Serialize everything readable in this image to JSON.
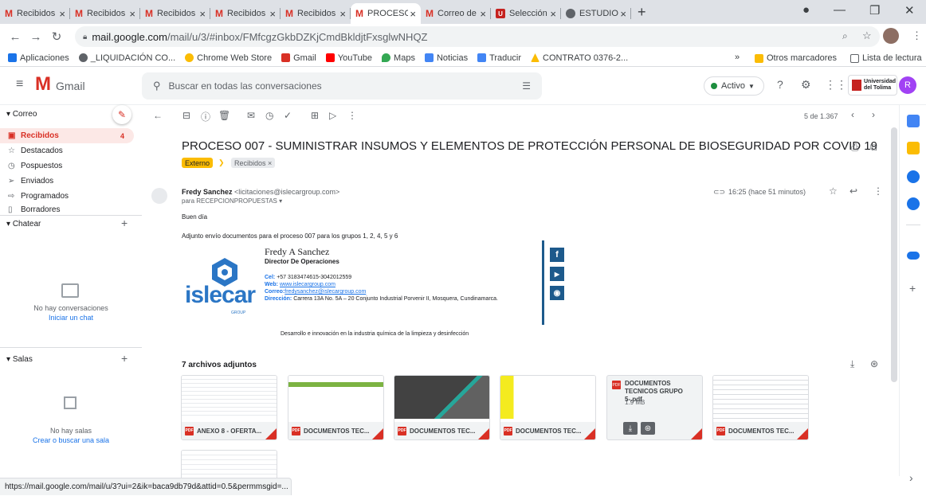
{
  "tabs": [
    {
      "label": "Recibidos (",
      "favicon": "gmail-icon",
      "active": false
    },
    {
      "label": "Recibidos (",
      "favicon": "gmail-icon",
      "active": false
    },
    {
      "label": "Recibidos (",
      "favicon": "gmail-icon",
      "active": false
    },
    {
      "label": "Recibidos (",
      "favicon": "gmail-icon",
      "active": false
    },
    {
      "label": "Recibidos (",
      "favicon": "gmail-icon",
      "active": false
    },
    {
      "label": "PROCESO (",
      "favicon": "gmail-icon",
      "active": true
    },
    {
      "label": "Correo de",
      "favicon": "gmail-icon",
      "active": false
    },
    {
      "label": "Selección",
      "favicon": "university-icon",
      "active": false
    },
    {
      "label": "ESTUDIOS",
      "favicon": "globe-icon",
      "active": false
    }
  ],
  "address": {
    "host": "mail.google.com",
    "path": "/mail/u/3/#inbox/FMfcgzGkbDZKjCmdBkldjtFxsglwNHQZ"
  },
  "bookmarks": {
    "items": [
      {
        "label": "Aplicaciones",
        "color": "#1a73e8"
      },
      {
        "label": "_LIQUIDACIÓN CO...",
        "color": "#5f6368"
      },
      {
        "label": "Chrome Web Store",
        "color": "#fbbc04"
      },
      {
        "label": "Gmail",
        "color": "#d93025"
      },
      {
        "label": "YouTube",
        "color": "#ff0000"
      },
      {
        "label": "Maps",
        "color": "#34a853"
      },
      {
        "label": "Noticias",
        "color": "#4285f4"
      },
      {
        "label": "Traducir",
        "color": "#4285f4"
      },
      {
        "label": "CONTRATO 0376-2...",
        "color": "#fbbc04"
      }
    ],
    "more": "»",
    "otros": "Otros marcadores",
    "lista": "Lista de lectura"
  },
  "gmail": {
    "logo": "Gmail",
    "search_placeholder": "Buscar en todas las conversaciones",
    "status": "Activo",
    "university_logo_line1": "Universidad",
    "university_logo_line2": "del Tolima",
    "avatar_letter": "R"
  },
  "sidebar": {
    "correo_header": "Correo",
    "items": [
      {
        "label": "Recibidos",
        "count": "4",
        "icon": "inbox-icon",
        "selected": true
      },
      {
        "label": "Destacados",
        "count": "",
        "icon": "star-icon",
        "selected": false
      },
      {
        "label": "Pospuestos",
        "count": "",
        "icon": "clock-icon",
        "selected": false
      },
      {
        "label": "Enviados",
        "count": "",
        "icon": "send-icon",
        "selected": false
      },
      {
        "label": "Programados",
        "count": "",
        "icon": "scheduled-icon",
        "selected": false
      },
      {
        "label": "Borradores",
        "count": "",
        "icon": "draft-icon",
        "selected": false
      }
    ],
    "chatear_header": "Chatear",
    "no_conversations": "No hay conversaciones",
    "start_chat": "Iniciar un chat",
    "salas_header": "Salas",
    "no_rooms": "No hay salas",
    "create_room": "Crear o buscar una sala"
  },
  "toolbar": {
    "pagination": "5 de 1.367"
  },
  "email": {
    "subject": "PROCESO 007 - SUMINISTRAR INSUMOS Y ELEMENTOS DE PROTECCIÓN PERSONAL DE BIOSEGURIDAD POR COVID 19",
    "label_external": "Externo",
    "label_inbox": "Recibidos ×",
    "sender_name": "Fredy Sanchez",
    "sender_email": "<licitaciones@islecargroup.com>",
    "to": "para RECEPCIONPROPUESTAS ▾",
    "time": "16:25 (hace 51 minutos)",
    "greeting": "Buen día",
    "body": "Adjunto envío documentos para el proceso 007 para los grupos 1, 2, 4, 5 y 6"
  },
  "signature": {
    "name": "Fredy A Sanchez",
    "role": "Director De Operaciones",
    "cel_label": "Cel:",
    "cel": "+57 3183474615-3042012559",
    "web_label": "Web:",
    "web": "www.islecargroup.com",
    "correo_label": "Correo:",
    "correo": "fredysanchez@islecargroup.com",
    "dir_label": "Dirección:",
    "dir": "Carrera 13A No. 5A – 20 Conjunto Industrial Porvenir II, Mosquera, Cundinamarca.",
    "logo_text": "islecar",
    "logo_sub": "GROUP",
    "tagline": "Desarrollo e innovación en la industria química de la limpieza y desinfección"
  },
  "attachments": {
    "title": "7 archivos adjuntos",
    "items": [
      {
        "name": "ANEXO 8 - OFERTA..."
      },
      {
        "name": "DOCUMENTOS TEC..."
      },
      {
        "name": "DOCUMENTOS TEC..."
      },
      {
        "name": "DOCUMENTOS TEC..."
      },
      {
        "name": "DOCUMENTOS TECNICOS GRUPO 5-.pdf",
        "size": "1.9 MB"
      },
      {
        "name": "DOCUMENTOS TEC..."
      }
    ]
  },
  "status_url": "https://mail.google.com/mail/u/3?ui=2&ik=baca9db79d&attid=0.5&permmsgid=..."
}
